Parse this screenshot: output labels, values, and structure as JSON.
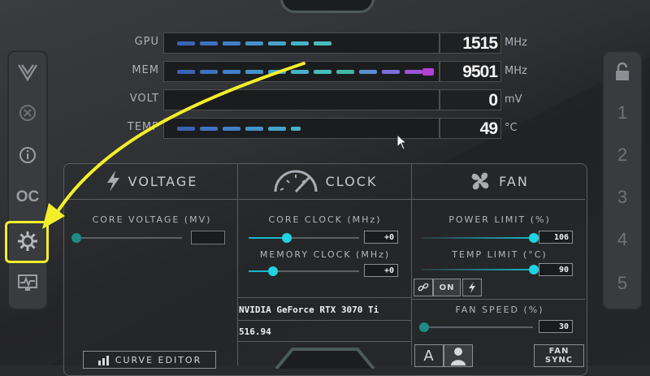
{
  "monitor": {
    "rows": [
      {
        "label": "GPU",
        "value": "1515",
        "unit": "MHz"
      },
      {
        "label": "MEM",
        "value": "9501",
        "unit": "MHz"
      },
      {
        "label": "VOLT",
        "value": "0",
        "unit": "mV"
      },
      {
        "label": "TEMP",
        "value": "49",
        "unit": "°C"
      }
    ]
  },
  "left_rail": {
    "icons": [
      "msi-dragon-icon",
      "close-circle-icon",
      "info-icon",
      "oc-scanner-icon",
      "settings-gear-icon",
      "monitor-graph-icon"
    ],
    "oc_label": "OC"
  },
  "right_rail": {
    "lock_icon": "lock-open-icon",
    "profiles": [
      "1",
      "2",
      "3",
      "4",
      "5"
    ]
  },
  "sections": {
    "voltage": {
      "title": "VOLTAGE",
      "icon": "lightning-icon"
    },
    "clock": {
      "title": "CLOCK",
      "icon": "speedometer-icon"
    },
    "fan": {
      "title": "FAN",
      "icon": "fan-icon"
    }
  },
  "controls": {
    "core_voltage_label": "CORE VOLTAGE  (MV)",
    "core_voltage_value": "",
    "core_clock_label": "CORE CLOCK (MHz)",
    "core_clock_value": "+0",
    "memory_clock_label": "MEMORY CLOCK (MHz)",
    "memory_clock_value": "+0",
    "power_limit_label": "POWER LIMIT (%)",
    "power_limit_value": "106",
    "temp_limit_label": "TEMP LIMIT (°C)",
    "temp_limit_value": "90",
    "fan_speed_label": "FAN SPEED (%)",
    "fan_speed_value": "30",
    "link_on_label": "ON",
    "fan_sync_label": "FAN SYNC",
    "auto_label": "A",
    "curve_editor_label": "CURVE EDITOR"
  },
  "gpu_info": {
    "name": "NVIDIA GeForce RTX 3070 Ti",
    "driver": "516.94"
  },
  "colors": {
    "accent": "#1fd3e2",
    "annotation": "#f2ef2a",
    "mem_bar_end": "#b43fd6"
  }
}
